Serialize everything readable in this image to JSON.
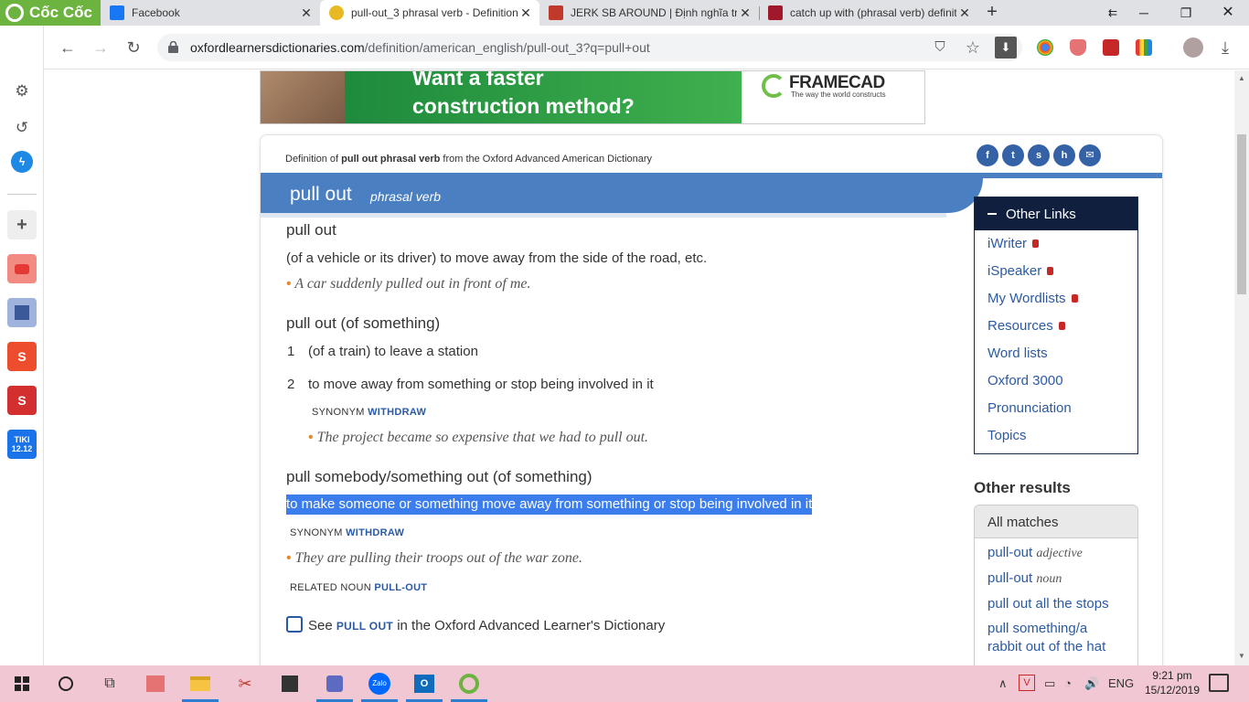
{
  "browser": {
    "brand": "Cốc Cốc",
    "tabs": [
      {
        "title": "Facebook",
        "active": false
      },
      {
        "title": "pull-out_3 phrasal verb - Definition",
        "active": true
      },
      {
        "title": "JERK SB AROUND | Định nghĩa tro",
        "active": false
      },
      {
        "title": "catch up with (phrasal verb) definit",
        "active": false
      }
    ],
    "url_domain": "oxfordlearnersdictionaries.com",
    "url_path": "/definition/american_english/pull-out_3?q=pull+out"
  },
  "sidebar": {
    "tiki_label": "TIKI\n12.12"
  },
  "ad": {
    "tagline_1": "Want a faster",
    "tagline_2": "construction method?",
    "brand": "FRAMECAD",
    "brand_sub": "The way the world constructs"
  },
  "entry": {
    "source_prefix": "Definition of ",
    "source_term": "pull out phrasal verb",
    "source_suffix": " from the Oxford Advanced American Dictionary",
    "headword": "pull out",
    "pos": "phrasal verb",
    "senses": [
      {
        "phrase": "pull out",
        "def": "(of a vehicle or its driver) to move away from the side of the road, etc.",
        "example": "A car suddenly pulled out in front of me."
      },
      {
        "phrase": "pull out (of something)",
        "def1_num": "1",
        "def1": "(of a train) to leave a station",
        "def2_num": "2",
        "def2": "to move away from something or stop being involved in it",
        "syn_label": "SYNONYM",
        "syn_word": "WITHDRAW",
        "example": "The project became so expensive that we had to pull out."
      },
      {
        "phrase": "pull somebody/something out (of something)",
        "def": "to make someone or something move away from something or stop being involved in it",
        "syn_label": "SYNONYM",
        "syn_word": "WITHDRAW",
        "example": "They are pulling their troops out of the war zone.",
        "rel_label": "RELATED NOUN",
        "rel_word": "PULL-OUT"
      }
    ],
    "see_prefix": "See ",
    "see_term": "PULL OUT",
    "see_suffix": " in the Oxford Advanced Learner's Dictionary"
  },
  "other_links": {
    "title": "Other Links",
    "items": [
      "iWriter",
      "iSpeaker",
      "My Wordlists",
      "Resources",
      "Word lists",
      "Oxford 3000",
      "Pronunciation",
      "Topics"
    ]
  },
  "other_results": {
    "title": "Other results",
    "all_matches": "All matches",
    "items": [
      {
        "text": "pull-out",
        "pos": "adjective"
      },
      {
        "text": "pull-out",
        "pos": "noun"
      },
      {
        "text": "pull out all the stops",
        "pos": ""
      },
      {
        "text": "pull something/a rabbit out of the hat",
        "pos": ""
      }
    ]
  },
  "taskbar": {
    "lang": "ENG",
    "time": "9:21 pm",
    "date": "15/12/2019",
    "zalo": "Zalo"
  }
}
